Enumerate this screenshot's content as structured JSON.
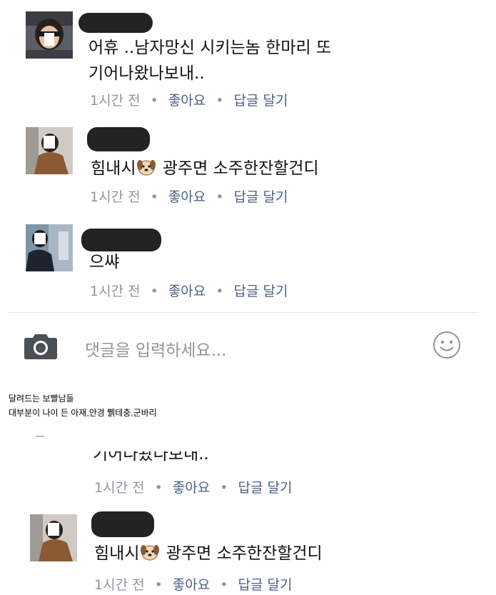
{
  "comments": [
    {
      "line1": "어휴 ..남자망신 시키는놈 한마리 또",
      "line2": "기어나왔나보내..",
      "time": "1시간 전",
      "like": "좋아요",
      "reply": "답글 달기"
    },
    {
      "line1_pre": "힘내시",
      "line1_post": " 광주면 소주한잔할건디",
      "emoji": "dog-face-icon",
      "time": "1시간 전",
      "like": "좋아요",
      "reply": "답글 달기"
    },
    {
      "line1": "으쌰",
      "time": "1시간 전",
      "like": "좋아요",
      "reply": "답글 달기"
    }
  ],
  "composer": {
    "placeholder": "댓글을 입력하세요...",
    "left_icon": "camera-icon",
    "right_icon": "smiley-icon"
  },
  "caption": {
    "line1": "달려드는 보빨남들",
    "line2": "대부분이 나이 든 아재,안경 쀍테충,군바리"
  },
  "repeat": [
    {
      "line_partial": "기어나왔나보내..",
      "time": "1시간 전",
      "like": "좋아요",
      "reply": "답글 달기"
    },
    {
      "line1_pre": "힘내시",
      "line1_post": " 광주면 소주한잔할건디",
      "emoji": "dog-face-icon",
      "time": "1시간 전",
      "like": "좋아요",
      "reply": "답글 달기"
    }
  ],
  "separator": "•",
  "colors": {
    "meta_gray": "#90949c",
    "link_blue": "#4b5f84",
    "censor": "#232323"
  }
}
